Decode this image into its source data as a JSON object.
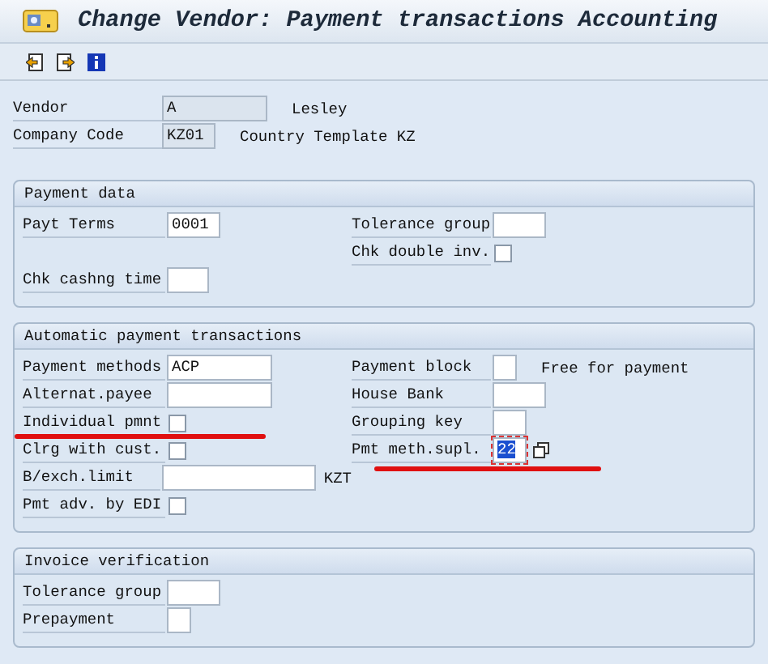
{
  "window": {
    "title": "Change Vendor: Payment transactions Accounting"
  },
  "toolbar": [
    {
      "kind": "previous"
    },
    {
      "kind": "next"
    },
    {
      "kind": "info"
    }
  ],
  "header": [
    {
      "label": "Vendor",
      "kind": "wide",
      "value": "A",
      "description": "Lesley"
    },
    {
      "label": "Company Code",
      "kind": "code",
      "value": "KZ01",
      "description": "Country Template KZ"
    }
  ],
  "sections": [
    {
      "title": "Payment data",
      "rows": [
        {
          "left": {
            "label": "Payt Terms",
            "kind": "code",
            "value": "0001"
          },
          "right": {
            "label": "Tolerance group",
            "kind": "code"
          }
        },
        {
          "right": {
            "label": "Chk double inv.",
            "kind": "checkbox",
            "checked": false
          }
        },
        {
          "left": {
            "label": "Chk cashng time",
            "kind": "short"
          }
        }
      ]
    },
    {
      "title": "Automatic payment transactions",
      "rows": [
        {
          "left": {
            "label": "Payment methods",
            "kind": "wide",
            "value": "ACP"
          },
          "right": {
            "label": "Payment block",
            "kind": "flag",
            "suffix": "Free for payment"
          }
        },
        {
          "left": {
            "label": "Alternat.payee",
            "kind": "wide"
          },
          "right": {
            "label": "House Bank",
            "kind": "code"
          }
        },
        {
          "left": {
            "label": "Individual pmnt",
            "kind": "checkbox",
            "checked": false,
            "underlined": true
          },
          "right": {
            "label": "Grouping key",
            "kind": "pair"
          }
        },
        {
          "left": {
            "label": "Clrg with cust.",
            "kind": "checkbox",
            "checked": false
          },
          "right": {
            "label": "Pmt meth.supl.",
            "kind": "pair",
            "value": "22",
            "focused": true,
            "value_help": true,
            "underlined": true
          }
        },
        {
          "left": {
            "label": "B/exch.limit",
            "kind": "xwide",
            "suffix": "KZT"
          }
        },
        {
          "left": {
            "label": "Pmt adv. by EDI",
            "kind": "checkbox",
            "checked": false
          }
        }
      ]
    },
    {
      "title": "Invoice verification",
      "rows": [
        {
          "left": {
            "label": "Tolerance group",
            "kind": "code"
          }
        },
        {
          "left": {
            "label": "Prepayment",
            "kind": "flag"
          }
        }
      ]
    }
  ]
}
